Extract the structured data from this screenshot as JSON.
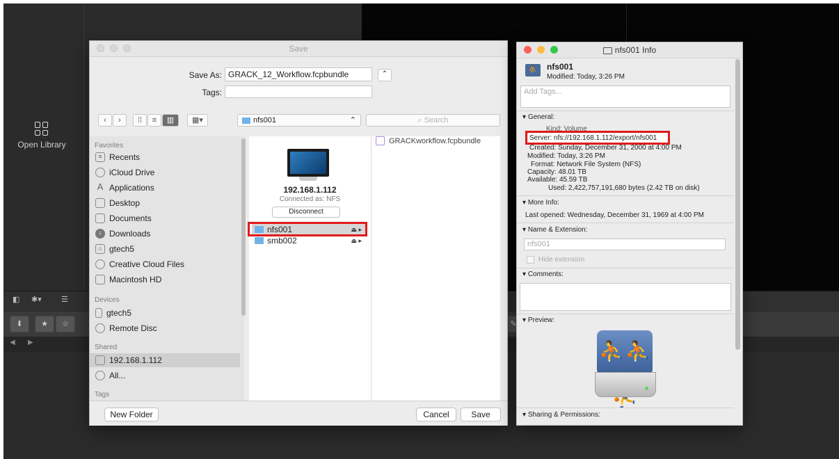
{
  "background_app": {
    "open_library_label": "Open Library"
  },
  "save_dialog": {
    "title": "Save",
    "save_as_label": "Save As:",
    "save_as_value": "GRACK_12_Workflow.fcpbundle",
    "tags_label": "Tags:",
    "tags_value": "",
    "location": "nfs001",
    "search_placeholder": "Search",
    "sidebar": {
      "favorites_header": "Favorites",
      "favorites": [
        "Recents",
        "iCloud Drive",
        "Applications",
        "Desktop",
        "Documents",
        "Downloads",
        "gtech5",
        "Creative Cloud Files",
        "Macintosh HD"
      ],
      "devices_header": "Devices",
      "devices": [
        "gtech5",
        "Remote Disc"
      ],
      "shared_header": "Shared",
      "shared": [
        "192.168.1.112",
        "All..."
      ],
      "tags_header": "Tags"
    },
    "server": {
      "name": "192.168.1.112",
      "connected_as": "Connected as: NFS",
      "disconnect_label": "Disconnect",
      "volumes": [
        "nfs001",
        "smb002"
      ]
    },
    "file_item": "GRACKworkflow.fcpbundle",
    "new_folder_label": "New Folder",
    "cancel_label": "Cancel",
    "save_label": "Save"
  },
  "info_window": {
    "title": "nfs001 Info",
    "name": "nfs001",
    "modified_header": "Modified: Today, 3:26 PM",
    "add_tags_placeholder": "Add Tags...",
    "general_header": "General:",
    "kind": "Kind: Volume",
    "server": "Server: nfs://192.168.1.112/export/nfs001",
    "created": "Created: Sunday, December 31, 2000 at 4:00 PM",
    "modified": "Modified: Today, 3:26 PM",
    "format": "Format: Network File System (NFS)",
    "capacity": "Capacity: 48.01 TB",
    "available": "Available: 45.59 TB",
    "used": "Used: 2,422,757,191,680 bytes (2.42 TB on disk)",
    "more_info_header": "More Info:",
    "last_opened": "Last opened: Wednesday, December 31, 1969 at 4:00 PM",
    "name_ext_header": "Name & Extension:",
    "name_field_value": "nfs001",
    "hide_extension_label": "Hide extension",
    "comments_header": "Comments:",
    "preview_header": "Preview:",
    "sharing_header": "Sharing & Permissions:"
  }
}
